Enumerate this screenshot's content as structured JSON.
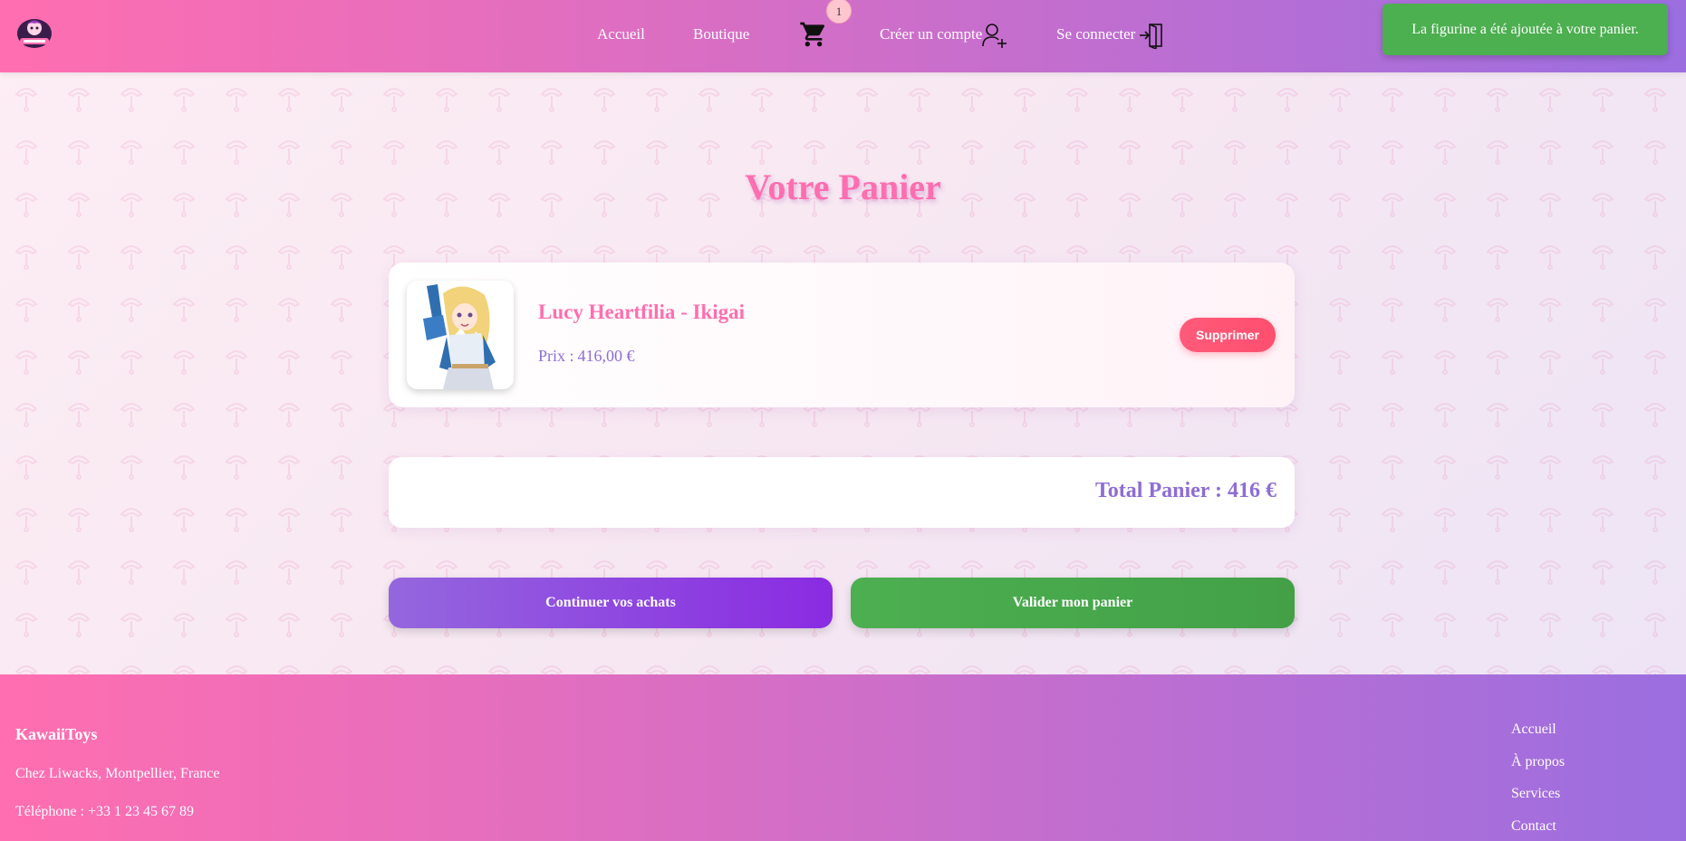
{
  "header": {
    "nav": {
      "home": "Accueil",
      "shop": "Boutique",
      "create_account": "Créer un compte",
      "login": "Se connecter"
    },
    "cart_count": "1"
  },
  "toast": {
    "message": "La figurine a été ajoutée à votre panier."
  },
  "cart": {
    "title": "Votre Panier",
    "items": [
      {
        "name": "Lucy Heartfilia - Ikigai",
        "price_label": "Prix :",
        "price": "416,00 €",
        "remove_label": "Supprimer"
      }
    ],
    "total_label": "Total Panier :",
    "total_value": "416 €",
    "continue_label": "Continuer vos achats",
    "validate_label": "Valider mon panier"
  },
  "footer": {
    "brand": "KawaiiToys",
    "address": "Chez Liwacks, Montpellier, France",
    "phone": "Téléphone : +33 1 23 45 67 89",
    "links": [
      "Accueil",
      "À propos",
      "Services",
      "Contact"
    ]
  },
  "colors": {
    "accent_pink": "#ff6eb0",
    "accent_purple": "#8e6dd6",
    "success_green": "#4caf50",
    "danger_red": "#ff5a7a"
  }
}
